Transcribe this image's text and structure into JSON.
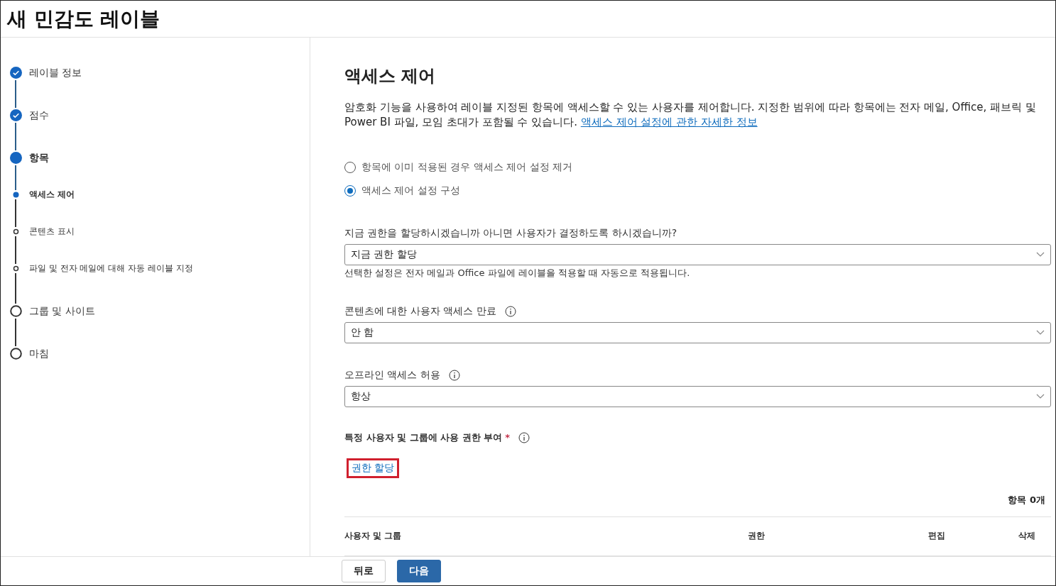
{
  "window": {
    "title": "새 민감도 레이블"
  },
  "steps": [
    {
      "label": "레이블 정보",
      "kind": "step",
      "done": true,
      "current": false,
      "selected": false
    },
    {
      "label": "점수",
      "kind": "step",
      "done": true,
      "current": false,
      "selected": false
    },
    {
      "label": "항목",
      "kind": "step",
      "done": false,
      "current": true,
      "selected": false
    },
    {
      "label": "액세스 제어",
      "kind": "substep",
      "done": false,
      "current": true,
      "selected": true
    },
    {
      "label": "콘텐츠 표시",
      "kind": "substep",
      "done": false,
      "current": false,
      "selected": false
    },
    {
      "label": "파일 및 전자 메일에 대해 자동 레이블 지정",
      "kind": "substep",
      "done": false,
      "current": false,
      "selected": false
    },
    {
      "label": "그룹 및 사이트",
      "kind": "step",
      "done": false,
      "current": false,
      "selected": false
    },
    {
      "label": "마침",
      "kind": "step",
      "done": false,
      "current": false,
      "selected": false
    }
  ],
  "content": {
    "heading": "액세스 제어",
    "description": "암호화 기능을 사용하여 레이블 지정된 항목에 액세스할 수 있는 사용자를 제어합니다. 지정한 범위에 따라 항목에는 전자 메일, Office, 패브릭 및 Power BI 파일, 모임 초대가 포함될 수 있습니다.",
    "description_link": "액세스 제어 설정에 관한 자세한 정보",
    "radios": [
      {
        "label": "항목에 이미 적용된 경우 액세스 제어 설정 제거",
        "selected": false
      },
      {
        "label": "액세스 제어 설정 구성",
        "selected": true
      }
    ],
    "fields": [
      {
        "label": "지금 권한을 할당하시겠습니까 아니면 사용자가 결정하도록 하시겠습니까?",
        "info": false,
        "value": "지금 권한 할당",
        "helper": "선택한 설정은 전자 메일과 Office 파일에 레이블을 적용할 때 자동으로 적용됩니다."
      },
      {
        "label": "콘텐츠에 대한 사용자 액세스 만료",
        "info": true,
        "value": "안 함"
      },
      {
        "label": "오프라인 액세스 허용",
        "info": true,
        "value": "항상"
      }
    ],
    "permissions": {
      "label": "특정 사용자 및 그룹에 사용 권한 부여",
      "required_mark": "*",
      "assign_link": "권한 할당",
      "highlighted": true,
      "count": "항목 0개",
      "columns": [
        "사용자 및 그룹",
        "권한",
        "편집",
        "삭제"
      ]
    }
  },
  "footer": {
    "back": "뒤로",
    "next": "다음"
  }
}
